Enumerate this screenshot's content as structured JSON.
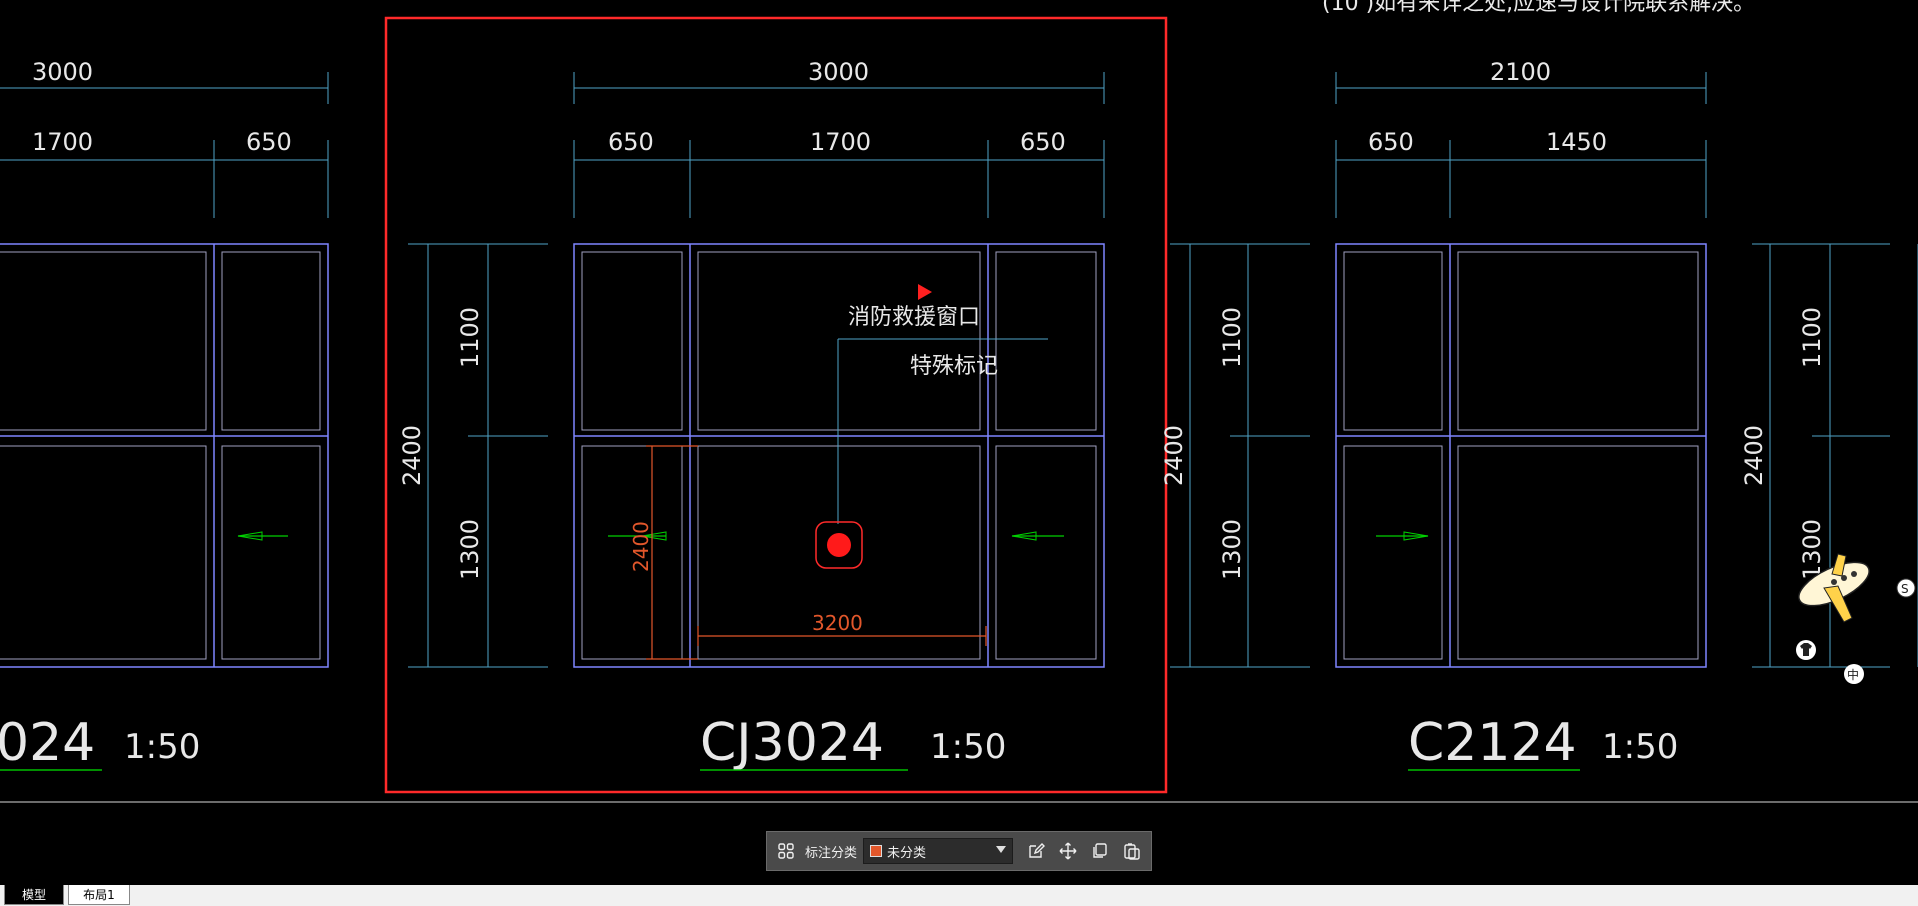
{
  "drawing": {
    "note_top": "(10 )如有来详之处,应速与设计院联系解决。",
    "left_panel": {
      "dim_total": "3000",
      "dim_left": "1700",
      "dim_right": "650",
      "title": "024",
      "scale": "1:50"
    },
    "center_panel": {
      "dim_total": "3000",
      "dim_a": "650",
      "dim_b": "1700",
      "dim_c": "650",
      "dim_height": "2400",
      "dim_upper": "1100",
      "dim_lower": "1300",
      "label_rescue": "消防救援窗口",
      "label_special": "特殊标记",
      "dim_red_width": "3200",
      "dim_red_height": "2400",
      "title": "CJ3024",
      "scale": "1:50"
    },
    "right_panel": {
      "dim_total": "2100",
      "dim_a": "650",
      "dim_b": "1450",
      "dim_height": "2400",
      "dim_upper": "1100",
      "dim_lower": "1300",
      "title": "C2124",
      "scale": "1:50"
    },
    "far_right": {
      "dim_height": "2400",
      "dim_upper": "1100",
      "dim_lower": "1300",
      "float_badge_s": "S",
      "float_badge_zh": "中"
    }
  },
  "toolbar": {
    "category_label": "标注分类",
    "selected_value": "未分类",
    "swatch_color": "#e2572b",
    "icons": [
      "grid-icon",
      "edit-icon",
      "move-icon",
      "copy-icon",
      "paste-icon"
    ]
  },
  "tabs": [
    "模型",
    "布局1"
  ],
  "colors": {
    "frame_blue": "#7f86ff",
    "dim_cyan": "#4fa3c7",
    "highlight_red": "#ff2a2a",
    "green_arrow": "#00d000",
    "orange": "#e2572b"
  }
}
